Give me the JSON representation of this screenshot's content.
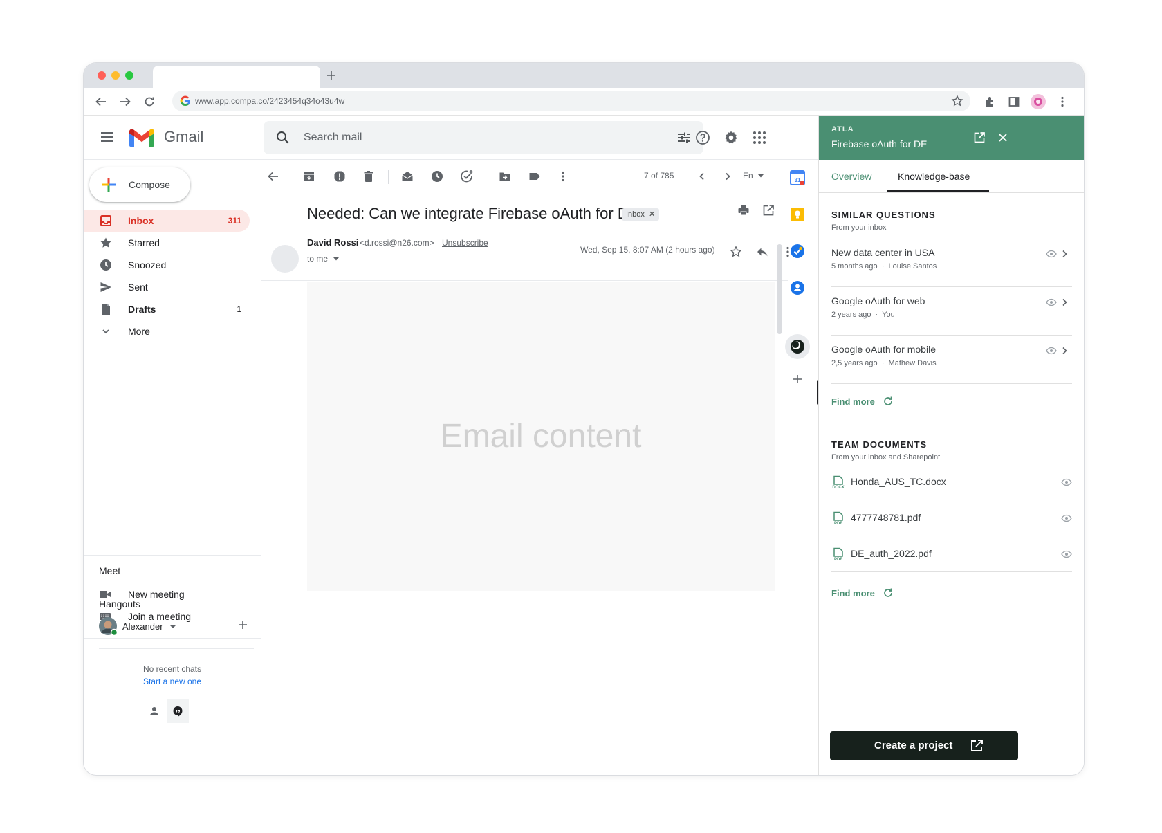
{
  "browser": {
    "url": "www.app.compa.co/2423454q34o43u4w"
  },
  "gmail": {
    "logo_text": "Gmail",
    "search_placeholder": "Search mail",
    "compose_label": "Compose",
    "nav": [
      {
        "label": "Inbox",
        "count": "311",
        "icon": "inbox-icon",
        "active": true
      },
      {
        "label": "Starred",
        "count": "",
        "icon": "star-icon"
      },
      {
        "label": "Snoozed",
        "count": "",
        "icon": "clock-icon"
      },
      {
        "label": "Sent",
        "count": "",
        "icon": "send-icon"
      },
      {
        "label": "Drafts",
        "count": "1",
        "icon": "draft-icon"
      },
      {
        "label": "More",
        "count": "",
        "icon": "chevron-down-icon"
      }
    ],
    "meet": {
      "title": "Meet",
      "new_meeting": "New meeting",
      "join_meeting": "Join a meeting"
    },
    "hangouts": {
      "title": "Hangouts",
      "user": "Alexander",
      "no_chats": "No recent chats",
      "start_new": "Start a new one"
    },
    "toolbar": {
      "pager": "7 of 785",
      "lang": "En"
    },
    "email": {
      "subject": "Needed: Can we integrate Firebase oAuth for DE",
      "chip": "Inbox",
      "sender_name": "David Rossi",
      "sender_email": "<d.rossi@n26.com>",
      "unsubscribe": "Unsubscribe",
      "to": "to me",
      "date": "Wed, Sep 15, 8:07 AM (2 hours ago)",
      "body_placeholder": "Email content"
    }
  },
  "atla": {
    "brand": "ATLA",
    "title": "Firebase oAuth for DE",
    "tabs": {
      "overview": "Overview",
      "knowledge": "Knowledge-base"
    },
    "similar": {
      "heading": "SIMILAR QUESTIONS",
      "sub": "From your inbox",
      "items": [
        {
          "title": "New data center in USA",
          "age": "5 months ago",
          "author": "Louise Santos"
        },
        {
          "title": "Google oAuth for web",
          "age": "2 years ago",
          "author": "You"
        },
        {
          "title": "Google oAuth for mobile",
          "age": "2,5 years ago",
          "author": "Mathew Davis"
        }
      ],
      "find_more": "Find more"
    },
    "docs": {
      "heading": "TEAM DOCUMENTS",
      "sub": "From your inbox and Sharepoint",
      "items": [
        {
          "name": "Honda_AUS_TC.docx",
          "type": "DOCX"
        },
        {
          "name": "4777748781.pdf",
          "type": "PDF"
        },
        {
          "name": "DE_auth_2022.pdf",
          "type": "PDF"
        }
      ],
      "find_more": "Find more"
    },
    "create_label": "Create a project",
    "accent": "#4a8f72"
  }
}
